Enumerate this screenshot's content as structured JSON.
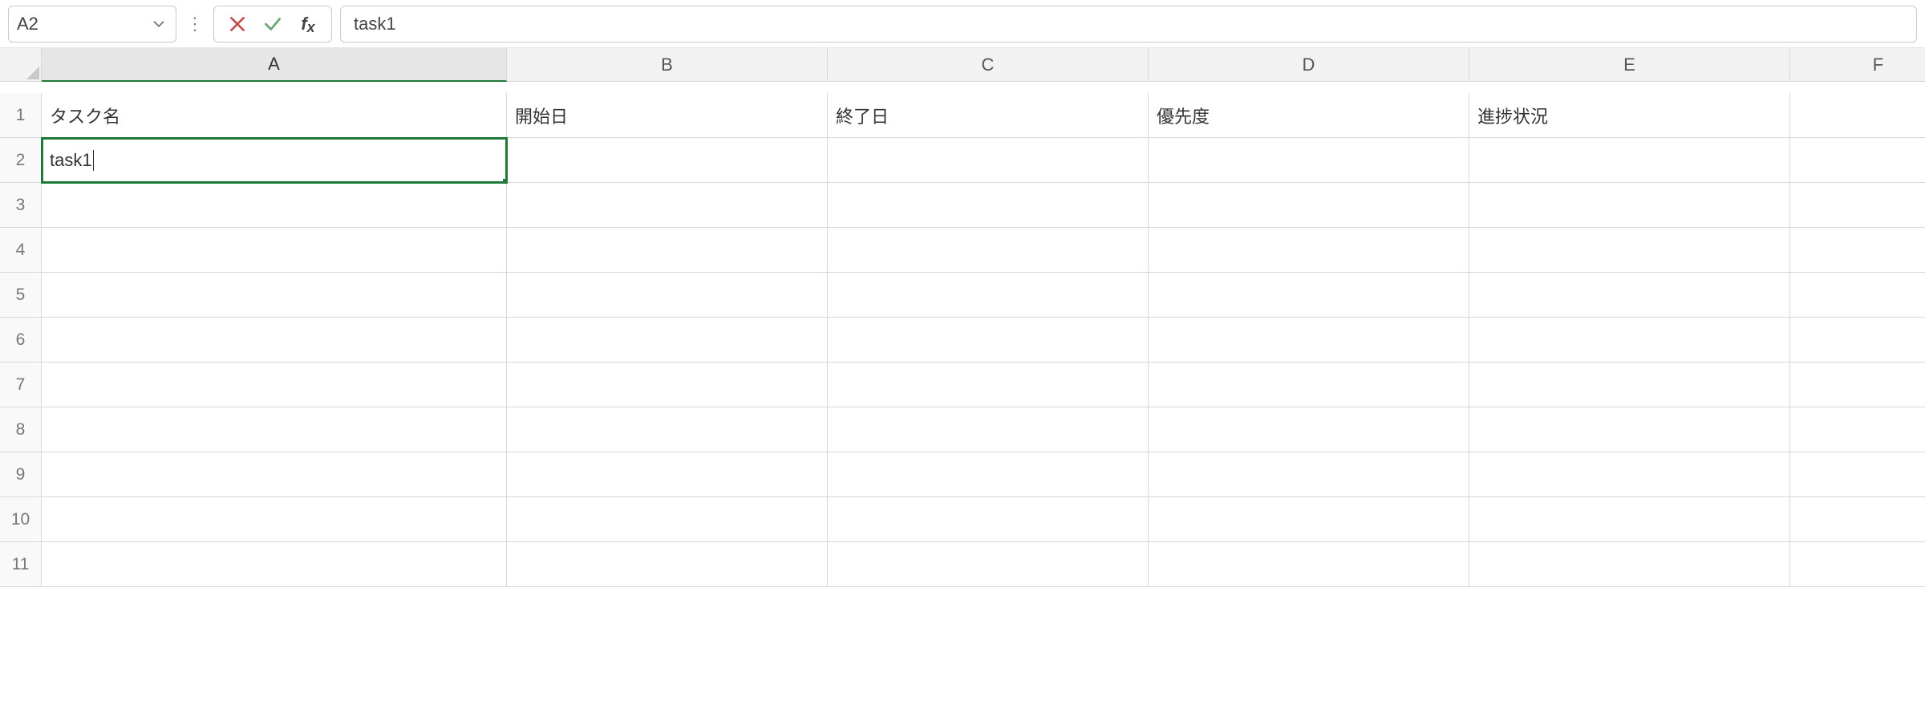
{
  "formula_bar": {
    "name_box": "A2",
    "formula_value": "task1"
  },
  "columns": [
    "A",
    "B",
    "C",
    "D",
    "E",
    "F"
  ],
  "row_numbers": [
    1,
    2,
    3,
    4,
    5,
    6,
    7,
    8,
    9,
    10,
    11
  ],
  "cells": {
    "A1": "タスク名",
    "B1": "開始日",
    "C1": "終了日",
    "D1": "優先度",
    "E1": "進捗状況",
    "A2": "task1"
  },
  "active_cell": "A2",
  "editing": true
}
